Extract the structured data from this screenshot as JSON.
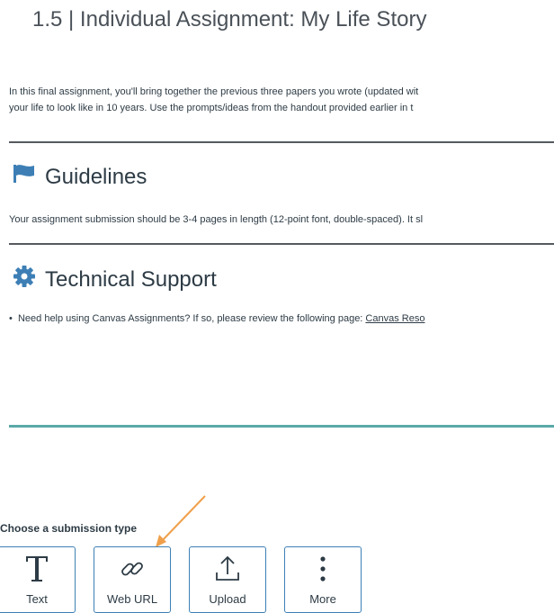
{
  "page": {
    "title": "1.5 | Individual Assignment: My Life Story",
    "intro_line1": "In this final assignment, you'll bring together the previous three papers you wrote (updated wit",
    "intro_line2": "your life to look like in 10 years. Use the prompts/ideas from the handout provided earlier in t"
  },
  "guidelines": {
    "heading": "Guidelines",
    "icon": "flag-icon",
    "text": "Your assignment submission should be 3-4 pages in length (12-point font, double-spaced). It sl"
  },
  "support": {
    "heading": "Technical Support",
    "icon": "gear-icon",
    "bullet_text": "Need help using Canvas Assignments? If so, please review the following page: ",
    "link_text": "Canvas Reso"
  },
  "submission": {
    "label": "Choose a submission type",
    "types": [
      {
        "label": "Text",
        "icon": "text-icon"
      },
      {
        "label": "Web URL",
        "icon": "link-icon"
      },
      {
        "label": "Upload",
        "icon": "upload-icon"
      },
      {
        "label": "More",
        "icon": "more-icon"
      }
    ]
  },
  "colors": {
    "accent": "#3d7fb5",
    "teal": "#5aa9a8",
    "annotation_arrow": "#f0a04b",
    "text": "#2d3b45"
  }
}
